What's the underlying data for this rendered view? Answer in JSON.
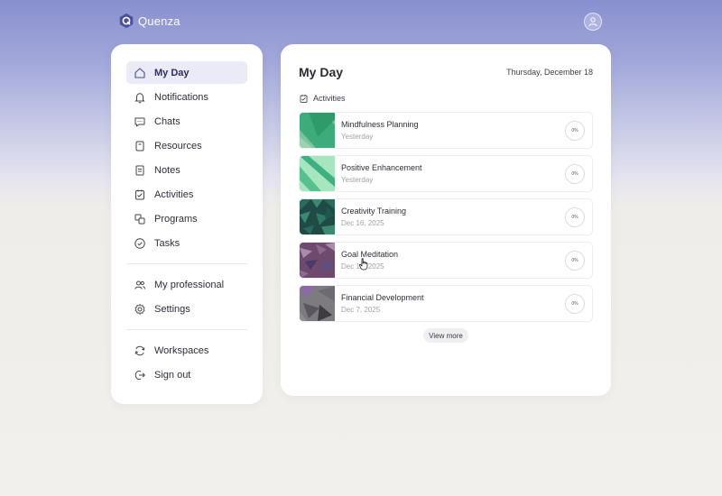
{
  "app": {
    "name": "Quenza"
  },
  "header": {
    "user_icon": "user-icon"
  },
  "sidebar": {
    "items": [
      {
        "label": "My Day",
        "icon": "home-icon",
        "active": true
      },
      {
        "label": "Notifications",
        "icon": "bell-icon"
      },
      {
        "label": "Chats",
        "icon": "chat-icon"
      },
      {
        "label": "Resources",
        "icon": "resources-icon"
      },
      {
        "label": "Notes",
        "icon": "notes-icon"
      },
      {
        "label": "Activities",
        "icon": "activities-icon"
      },
      {
        "label": "Programs",
        "icon": "programs-icon"
      },
      {
        "label": "Tasks",
        "icon": "check-circle-icon"
      }
    ],
    "secondary": [
      {
        "label": "My professional",
        "icon": "people-icon"
      },
      {
        "label": "Settings",
        "icon": "gear-icon"
      }
    ],
    "footer": [
      {
        "label": "Workspaces",
        "icon": "refresh-icon"
      },
      {
        "label": "Sign out",
        "icon": "sign-out-icon"
      }
    ]
  },
  "main": {
    "title": "My Day",
    "date": "Thursday, December 18",
    "section_label": "Activities",
    "activities": [
      {
        "title": "Mindfulness Planning",
        "date": "Yesterday",
        "progress": "0%"
      },
      {
        "title": "Positive Enhancement",
        "date": "Yesterday",
        "progress": "0%"
      },
      {
        "title": "Creativity Training",
        "date": "Dec 16, 2025",
        "progress": "0%"
      },
      {
        "title": "Goal Meditation",
        "date": "Dec 12, 2025",
        "progress": "0%"
      },
      {
        "title": "Financial Development",
        "date": "Dec 7, 2025",
        "progress": "0%"
      }
    ],
    "view_more": "View more"
  },
  "colors": {
    "accent": "#4a4d8c",
    "active_bg": "#ebebf8",
    "header_gradient_top": "#8990cf"
  }
}
